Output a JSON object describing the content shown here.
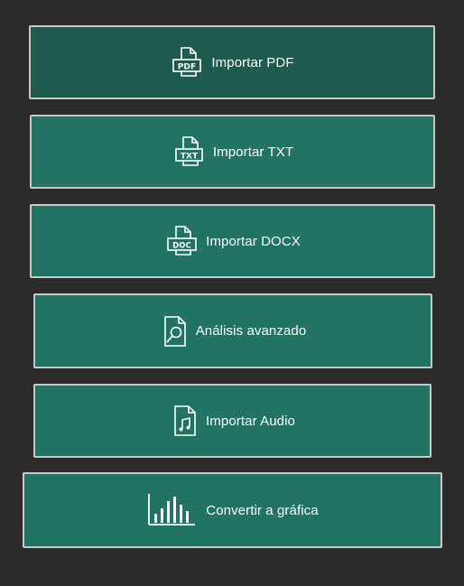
{
  "buttons": [
    {
      "label": "Importar PDF",
      "icon": "pdf-file-icon"
    },
    {
      "label": "Importar TXT",
      "icon": "txt-file-icon"
    },
    {
      "label": "Importar DOCX",
      "icon": "docx-file-icon"
    },
    {
      "label": "Análisis avanzado",
      "icon": "file-search-icon"
    },
    {
      "label": "Importar Audio",
      "icon": "audio-file-icon"
    },
    {
      "label": "Convertir a gráfica",
      "icon": "bar-chart-icon"
    }
  ],
  "colors": {
    "background": "#2b2b2b",
    "button": "#217463",
    "button_active": "#1e5b4e",
    "border": "#c9c9c9",
    "text": "#ffffff"
  }
}
